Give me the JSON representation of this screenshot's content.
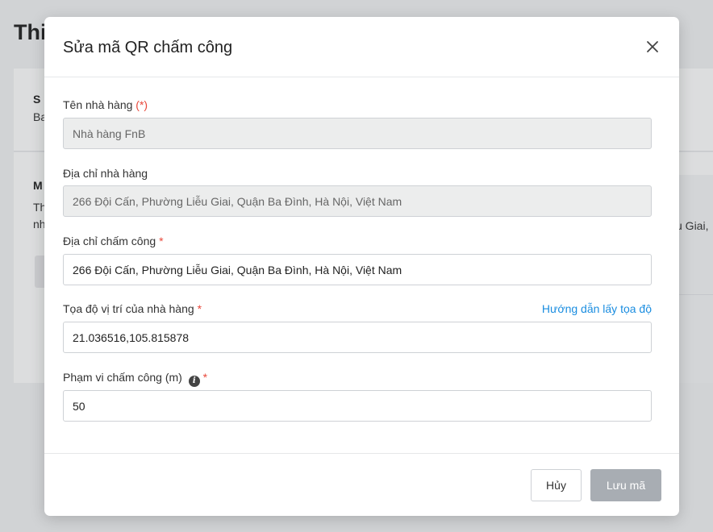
{
  "background": {
    "page_title": "Thi",
    "card1": {
      "title": "S",
      "text": "Ba"
    },
    "card2": {
      "title": "M",
      "line1": "Th",
      "line2": "nh"
    },
    "right_text": "u Giai,"
  },
  "modal": {
    "title": "Sửa mã QR chấm công",
    "fields": {
      "restaurant_name": {
        "label": "Tên nhà hàng",
        "required_mark": "(*)",
        "value": "Nhà hàng FnB"
      },
      "restaurant_address": {
        "label": "Địa chỉ nhà hàng",
        "value": "266 Đội Cấn, Phường Liễu Giai, Quận Ba Đình, Hà Nội, Việt Nam"
      },
      "checkin_address": {
        "label": "Địa chỉ chấm công",
        "required_mark": "*",
        "value": "266 Đội Cấn, Phường Liễu Giai, Quận Ba Đình, Hà Nội, Việt Nam"
      },
      "coordinates": {
        "label": "Tọa độ vị trí của nhà hàng",
        "required_mark": "*",
        "help_link": "Hướng dẫn lấy tọa độ",
        "value": "21.036516,105.815878"
      },
      "checkin_range": {
        "label": "Phạm vi chấm công (m)",
        "info_icon": "i",
        "required_mark": "*",
        "value": "50"
      }
    },
    "buttons": {
      "cancel": "Hủy",
      "save": "Lưu mã"
    },
    "colors": {
      "required": "#e8473a",
      "link": "#1a8de0",
      "save_disabled": "#a8adb3"
    },
    "icons": {
      "close": "close-icon",
      "info": "info-icon"
    }
  }
}
